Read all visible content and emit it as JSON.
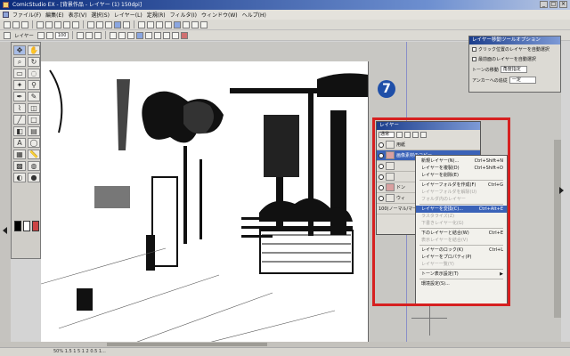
{
  "window": {
    "title": "ComicStudio EX - [背景作品 - レイヤー (1) 150dpi]",
    "buttons": [
      "_",
      "□",
      "×"
    ]
  },
  "menu": [
    "ファイル(F)",
    "編集(E)",
    "表示(V)",
    "選択(S)",
    "レイヤー(L)",
    "定規(R)",
    "フィルタ(I)",
    "ウィンドウ(W)",
    "ヘルプ(H)"
  ],
  "toolbar2": {
    "layer_label": "レイヤー",
    "zoom": "100"
  },
  "tool_options": {
    "title": "レイヤー移動ツールオプション",
    "option1": "クリック位置のレイヤーを自動選択",
    "option2": "最前面のレイヤーを自動選択",
    "tone_label": "トーンの移動",
    "tone_value": "角度指定",
    "anchor_label": "アンカーへの追従",
    "anchor_value": "一定"
  },
  "badge": {
    "number": "7"
  },
  "layer_panel": {
    "title": "レイヤー",
    "mode": "通常",
    "rows": [
      {
        "name": "用紙"
      },
      {
        "name": "画像素材のコピー"
      },
      {
        "name": ""
      },
      {
        "name": ""
      },
      {
        "name": "ドン"
      },
      {
        "name": "ウィ"
      }
    ],
    "footer": "100(ノーマル/マークカラー)"
  },
  "context_menu": {
    "items": [
      {
        "label": "新規レイヤー(N)...",
        "shortcut": "Ctrl+Shift+N",
        "state": "normal"
      },
      {
        "label": "レイヤーを複製(D)",
        "shortcut": "Ctrl+Shift+D",
        "state": "normal"
      },
      {
        "label": "レイヤーを削除(E)",
        "shortcut": "",
        "state": "normal"
      },
      {
        "sep": true
      },
      {
        "label": "レイヤーフォルダを作成(F)",
        "shortcut": "Ctrl+G",
        "state": "normal"
      },
      {
        "label": "レイヤーフォルダを解除(U)",
        "shortcut": "",
        "state": "disabled"
      },
      {
        "label": "フォルダ内のレイヤー",
        "shortcut": "",
        "state": "disabled"
      },
      {
        "sep": true
      },
      {
        "label": "レイヤーを変換(C)...",
        "shortcut": "Ctrl+Alt+E",
        "state": "highlight"
      },
      {
        "label": "ラスタライズ(Z)",
        "shortcut": "",
        "state": "disabled"
      },
      {
        "label": "下書きレイヤー化(G)",
        "shortcut": "",
        "state": "disabled"
      },
      {
        "sep": true
      },
      {
        "label": "下のレイヤーと結合(W)",
        "shortcut": "Ctrl+E",
        "state": "normal"
      },
      {
        "label": "表示レイヤーを結合(V)",
        "shortcut": "",
        "state": "disabled"
      },
      {
        "sep": true
      },
      {
        "label": "レイヤーのロック(K)",
        "shortcut": "Ctrl+L",
        "state": "normal"
      },
      {
        "label": "レイヤーをプロパティ(P)",
        "shortcut": "",
        "state": "normal"
      },
      {
        "label": "レイヤー一覧(Y)",
        "shortcut": "",
        "state": "disabled"
      },
      {
        "sep": true
      },
      {
        "label": "トーン表示設定(T)",
        "shortcut": "▶",
        "state": "normal"
      },
      {
        "sep": true
      },
      {
        "label": "環境設定(S)...",
        "shortcut": "",
        "state": "normal"
      }
    ]
  },
  "status": "50% 1.5 1 5 1 2 0.5 1...",
  "colors": {
    "callout": "#d62020",
    "badge": "#1f4fa8",
    "highlight": "#3a62b8"
  }
}
